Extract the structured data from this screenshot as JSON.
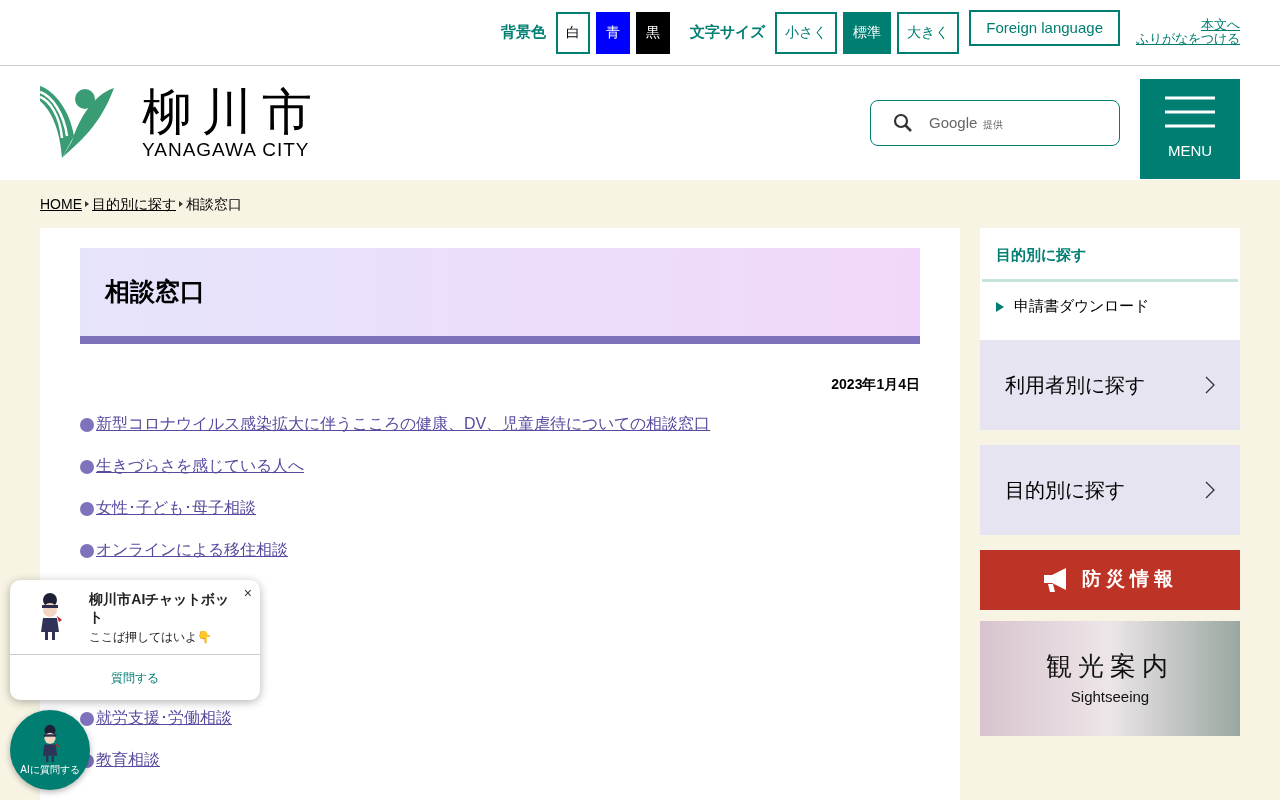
{
  "utility_bar": {
    "bg_label": "背景色",
    "bg_options": [
      {
        "label": "白",
        "kind": "white",
        "selected": false
      },
      {
        "label": "青",
        "kind": "blue",
        "selected": false
      },
      {
        "label": "黒",
        "kind": "black",
        "selected": false
      }
    ],
    "size_label": "文字サイズ",
    "size_options": [
      {
        "label": "小さく",
        "selected": false
      },
      {
        "label": "標準",
        "selected": true
      },
      {
        "label": "大きく",
        "selected": false
      }
    ],
    "foreign_language": "Foreign language",
    "skip_link": "本文へ",
    "furigana_link": "ふりがなをつける"
  },
  "header": {
    "logo_kanji": "柳川市",
    "logo_roman": "YANAGAWA CITY",
    "search": {
      "placeholder_brand": "Google",
      "placeholder_suffix": "提供"
    },
    "menu_label": "MENU"
  },
  "breadcrumb": [
    {
      "label": "HOME",
      "link": true
    },
    {
      "label": "目的別に探す",
      "link": true
    },
    {
      "label": "相談窓口",
      "link": false
    }
  ],
  "main": {
    "title": "相談窓口",
    "date": "2023年1月4日",
    "links_top": [
      "新型コロナウイルス感染拡大に伴うこころの健康、DV、児童虐待についての相談窓口",
      "生きづらさを感じている人へ",
      "女性･子ども･母子相談",
      "オンラインによる移住相談"
    ],
    "links_bottom": [
      "就労支援･労働相談",
      "教育相談"
    ]
  },
  "sidebar": {
    "section_title": "目的別に探す",
    "section_items": [
      "申請書ダウンロード"
    ],
    "nav_buttons": [
      "利用者別に探す",
      "目的別に探す"
    ],
    "disaster_button": "防災情報",
    "sightseeing_banner": {
      "title": "観光案内",
      "subtitle": "Sightseeing"
    }
  },
  "chatbot": {
    "title": "柳川市AIチャットボット",
    "message": "ここば押してはいよ👇",
    "close": "×",
    "ask_button": "質問する",
    "launcher_label": "AIに質問する"
  }
}
